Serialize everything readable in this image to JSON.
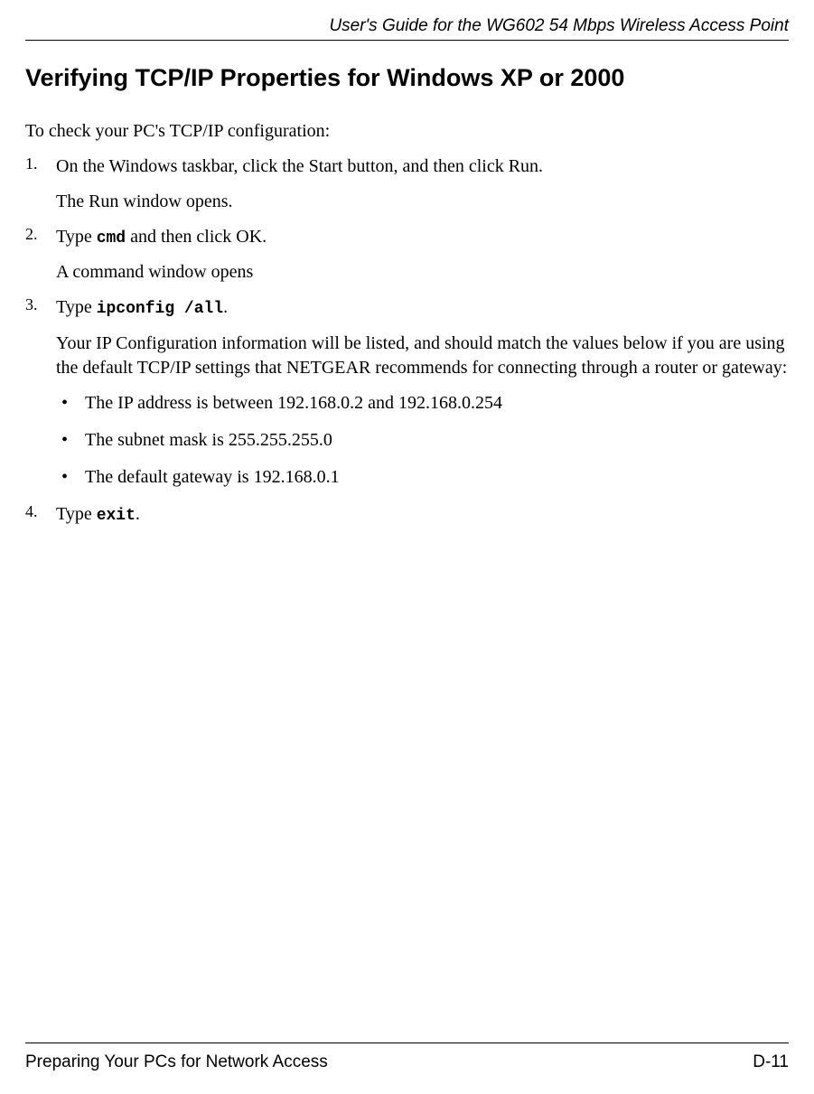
{
  "header": {
    "title": "User's Guide for the WG602 54 Mbps Wireless Access Point"
  },
  "heading": "Verifying TCP/IP Properties for Windows XP or 2000",
  "intro": "To check your PC's TCP/IP configuration:",
  "steps": [
    {
      "num": "1.",
      "text_pre": "On the Windows taskbar, click the Start button, and then click Run.",
      "result": "The Run window opens."
    },
    {
      "num": "2.",
      "type_label": "Type ",
      "mono": "cmd",
      "after_mono": " and then click OK.",
      "result": "A command window opens"
    },
    {
      "num": "3.",
      "type_label": "Type ",
      "mono": "ipconfig /all",
      "after_mono": ".",
      "result": "Your IP Configuration information will be listed, and should match the values below if you are using the default TCP/IP settings that NETGEAR recommends for connecting through a router or gateway:",
      "bullets": [
        "The IP address is between 192.168.0.2 and 192.168.0.254",
        "The subnet mask is 255.255.255.0",
        "The default gateway is 192.168.0.1"
      ]
    },
    {
      "num": "4.",
      "type_label": "Type ",
      "mono": "exit",
      "after_mono": "."
    }
  ],
  "footer": {
    "left": "Preparing Your PCs for Network Access",
    "right": "D-11"
  }
}
